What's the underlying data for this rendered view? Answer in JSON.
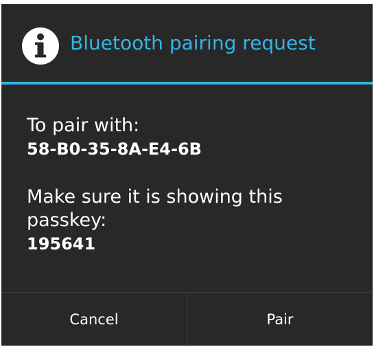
{
  "dialog": {
    "title": "Bluetooth pairing request",
    "title_icon": "info-icon",
    "accent_color": "#33b5e5",
    "background_color": "#282828",
    "pair_label": "To pair with:",
    "device_address": "58-B0-35-8A-E4-6B",
    "passkey_prompt_line1": "Make sure it is showing this",
    "passkey_prompt_line2": "passkey:",
    "passkey": "195641"
  },
  "buttons": {
    "cancel_label": "Cancel",
    "pair_label": "Pair"
  }
}
